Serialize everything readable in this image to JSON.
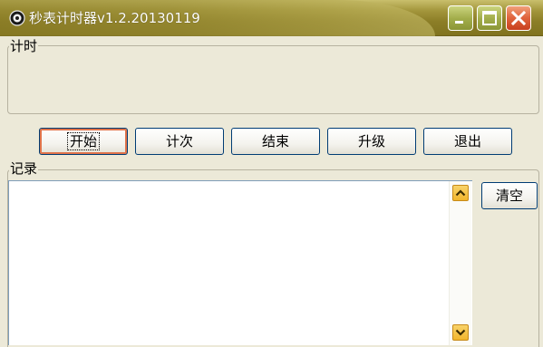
{
  "window": {
    "title": "秒表计时器v1.2.20130119",
    "icon": "stopwatch-icon",
    "controls": {
      "minimize": "minimize-icon",
      "maximize": "maximize-icon",
      "close": "close-icon"
    },
    "colors": {
      "titlebar": "#8c7e27",
      "close_button": "#e0633c",
      "face": "#ece9d8"
    }
  },
  "timer_group": {
    "label": "计时",
    "display": ""
  },
  "buttons": {
    "start": "开始",
    "lap": "计次",
    "stop": "结束",
    "upgrade": "升级",
    "exit": "退出"
  },
  "record_group": {
    "label": "记录",
    "items": [],
    "clear": "清空",
    "scroll_up": "scroll-up-icon",
    "scroll_down": "scroll-down-icon"
  }
}
